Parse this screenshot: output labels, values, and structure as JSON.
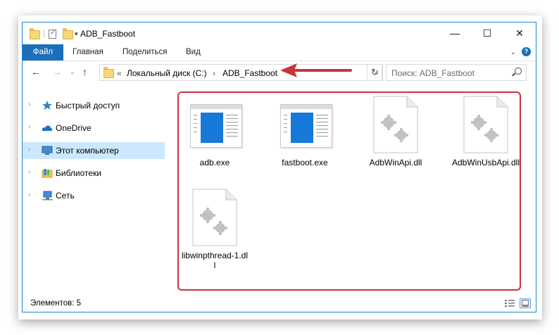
{
  "window": {
    "title": "ADB_Fastboot",
    "controls": {
      "minimize": "—",
      "maximize": "☐",
      "close": "✕"
    }
  },
  "ribbon": {
    "tabs": [
      "Файл",
      "Главная",
      "Поделиться",
      "Вид"
    ],
    "help": "?"
  },
  "address": {
    "overflow": "«",
    "segments": [
      "Локальный диск (C:)",
      "ADB_Fastboot"
    ],
    "separator": "›"
  },
  "search": {
    "placeholder": "Поиск: ADB_Fastboot"
  },
  "sidebar": {
    "items": [
      {
        "label": "Быстрый доступ",
        "icon": "star-icon",
        "selected": false
      },
      {
        "label": "OneDrive",
        "icon": "cloud-icon",
        "selected": false
      },
      {
        "label": "Этот компьютер",
        "icon": "computer-icon",
        "selected": true
      },
      {
        "label": "Библиотеки",
        "icon": "library-icon",
        "selected": false
      },
      {
        "label": "Сеть",
        "icon": "network-icon",
        "selected": false
      }
    ]
  },
  "files": [
    {
      "name": "adb.exe",
      "type": "exe"
    },
    {
      "name": "fastboot.exe",
      "type": "exe"
    },
    {
      "name": "AdbWinApi.dll",
      "type": "dll"
    },
    {
      "name": "AdbWinUsbApi.dll",
      "type": "dll"
    },
    {
      "name": "libwinpthread-1.dll",
      "type": "dll"
    }
  ],
  "status": {
    "text": "Элементов: 5"
  },
  "colors": {
    "accent": "#1a6fba",
    "selection": "#cce8ff",
    "annotation": "#c9333b",
    "window_border": "#1d84d0"
  }
}
